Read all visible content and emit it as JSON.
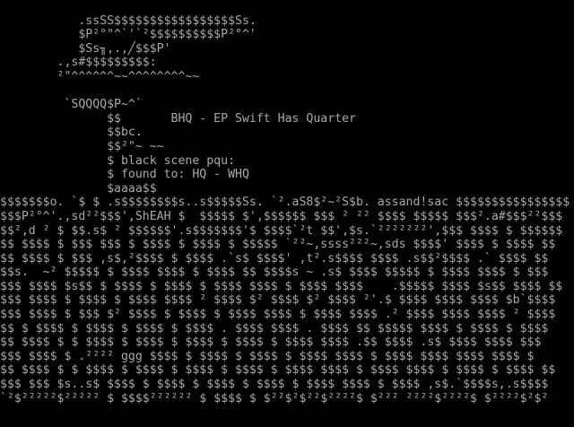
{
  "screen": {
    "foreground": "#a9a9a9",
    "background": "#000000",
    "lines": [
      "",
      "           .ssSS$$$$$$$$$$$$$$$$$Ss.",
      "           $P²°\"^`'`²$$$$$$$$$$P²°^'",
      "           $Ss╖,.,╱$$$P'",
      "        .,s#$$$$$$$$$:",
      "        ²\"^^^^^^~~^^^^^^^^~~",
      "",
      "         `SQQQQ$P~^`",
      "               $$       BHQ - EP Swift Has Quarter",
      "               $$bc.",
      "               $$²\"~ ~~",
      "               $ black scene pqu:",
      "               $ found to: HQ - WHQ",
      "               $aaaa$$",
      "$$$$$$$o. `$ $ .s$$$$$$$$s..s$$$$$Ss. `².aS8$²~²S$b. assand!sac $$$$$$$$$$$$$$$$",
      "$$$P²°^'.,sd²²$$$',ShEAH $  $$$$$ $',$$$$$$ $$$ ² ²² $$$$ $$$$$ $$$².a#$$$²²$$$",
      "$$²,d ² $ $$.s$ ² $$$$$$'.s$$$$$$$'$ $$$$`²t $$',$s.`²²²²²²²',$$$ $$$$ $ $$$$$$",
      "$$ $$$$ $ $$$ $$$ $ $$$$ $ $$$$ $ $$$$$ `²²~,ssss²²²~,sds $$$$' $$$$ $ $$$$ $$",
      "$$ $$$$ $ $$$ ,s$,²$$$$ $ $$$$ .`s$ $$$$' ,t².s$$$$ $$$$ .s$$²$$$$ .` $$$$ $$",
      "$$s.  ~² $$$$$ $ $$$$ $$$$ $ $$$$ $$ $$$$s ~ .s$ $$$$ $$$$$ $ $$$$ $$$$ $ $$$",
      "$$$ $$$$ $s$$ $ $$$$ $ $$$$ $ $$$$ $$$$ $ $$$$ $$$$    .$$$$$ $$$$ $s$$ $$$$ $$",
      "$$$ $$$$ $ $$$$ $ $$$$ $$$$ ² $$$$ $² $$$$ $² $$$$ ²'.$ $$$$ $$$$ $$$$ $b`$$$$",
      "$$$ $$$$ $ $$$ $² $$$$ $ $$$$ $ $$$$ $$$$ $ $$$$ $$$$ .² $$$$ $$$$ $$$$ ² $$$$",
      "$$ $ $$$$ $ $$$$ $ $$$$ $ $$$$ . $$$$ $$$$ . $$$$ $$ $$$$$ $$$$ $ $$$$ $ $$$$",
      "$$ $$$$ $ $ $$$$ $ $$$$ $ $$$$ $ $$$$ $ $$$$ $$$$ .$$ $$$$ .s$ $$$$ $$$$ $$$",
      "$$$ $$$$ $ .²²²² ggg $$$$ $ $$$$ $ $$$$ $ $$$$ $$$$ $ $$$$ $$$$ $$$$ $$$$ $",
      "$$ $$$$ $ $ $$$$ $ $$$$ $ $$$$ $ $$$$ $ $$$$ $$$$ $ $$$$ $$$$ $ $$$$ $ $$$$ $$",
      "$$$ $$$ $s..s$ $$$$ $ $$$$ $ $$$$ $ $$$$ $ $$$$ $$$$ $ $$$$ ,s$.`$$$$s,.s$$$$",
      "`²$²²²²²$²²²²² $ $$$$²²²²²² $ $$$$ $ $²²$²$²²$²²²²$ $²²² ²²²²$²²²²$ $²²²²$²$²"
    ]
  }
}
